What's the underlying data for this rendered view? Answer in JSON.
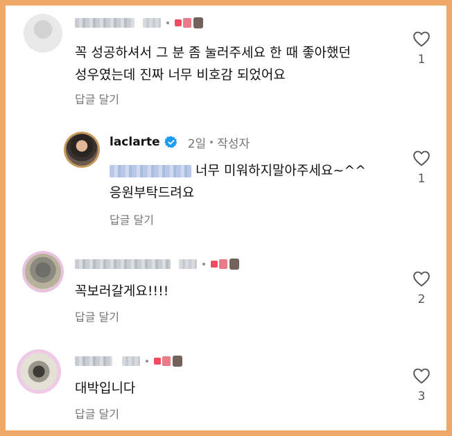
{
  "comments": [
    {
      "text_line1": "꼭 성공하셔서 그 분 좀 눌러주세요 한 때 좋아했던",
      "text_line2": "성우였는데 진짜 너무 비호감 되었어요",
      "reply_label": "답글 달기",
      "like_count": "1"
    },
    {
      "username": "laclarte",
      "verified": true,
      "time": "2일",
      "author_tag": "작성자",
      "text_line1": "너무 미워하지말아주세요~^^",
      "text_line2": "응원부탁드려요",
      "reply_label": "답글 달기",
      "like_count": "1"
    },
    {
      "text_line1": "꼭보러갈게요!!!!",
      "reply_label": "답글 달기",
      "like_count": "2"
    },
    {
      "text_line1": "대박입니다",
      "reply_label": "답글 달기",
      "like_count": "3"
    }
  ],
  "colors": {
    "background_frame": "#f0a868",
    "muted_text": "#737373",
    "verified_blue": "#1d9bf0"
  },
  "icons": {
    "like": "heart-outline-icon",
    "verified": "verified-badge-icon"
  }
}
